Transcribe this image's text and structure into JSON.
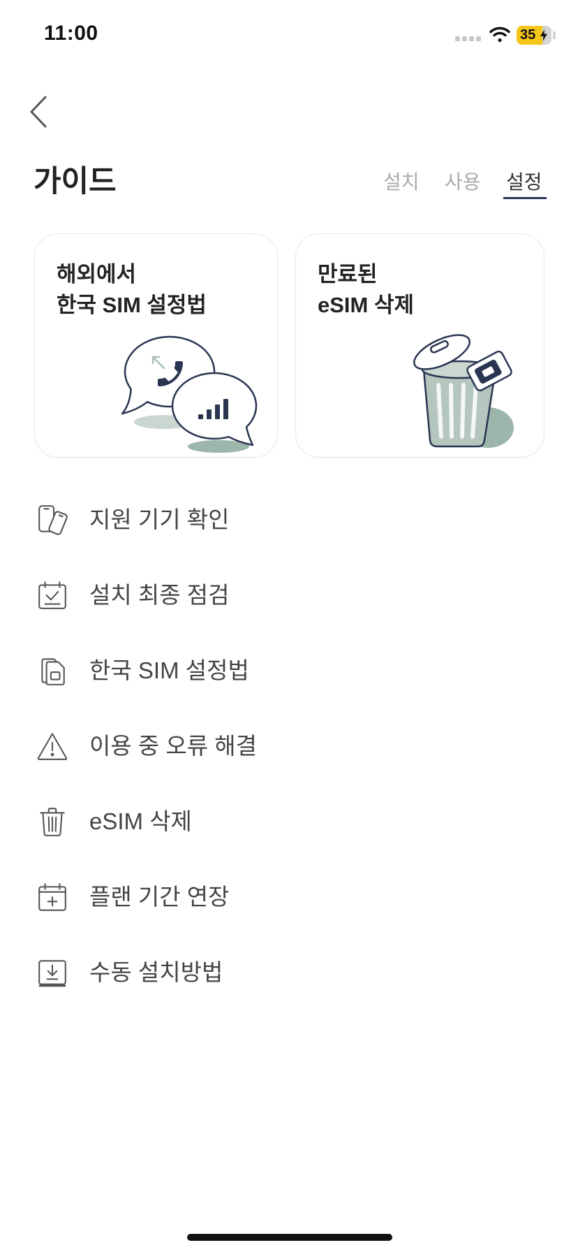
{
  "status_bar": {
    "time": "11:00",
    "battery_percent": "35",
    "icons": [
      "signal-dots-icon",
      "wifi-icon",
      "battery-icon",
      "charging-bolt-icon"
    ]
  },
  "nav": {
    "back_icon": "chevron-left-icon"
  },
  "header": {
    "title": "가이드",
    "tabs": [
      {
        "label": "설치",
        "selected": false
      },
      {
        "label": "사용",
        "selected": false
      },
      {
        "label": "설정",
        "selected": true
      }
    ]
  },
  "cards": [
    {
      "line1": "해외에서",
      "line2": "한국 SIM 설정법",
      "illustration": "speech-bubbles-phone-signal"
    },
    {
      "line1": "만료된",
      "line2": "eSIM 삭제",
      "illustration": "trash-can-phone"
    }
  ],
  "menu": {
    "items": [
      {
        "label": "지원 기기 확인",
        "icon": "devices-icon"
      },
      {
        "label": "설치 최종 점검",
        "icon": "calendar-check-icon"
      },
      {
        "label": "한국 SIM 설정법",
        "icon": "sim-cards-icon"
      },
      {
        "label": "이용 중 오류 해결",
        "icon": "warning-icon"
      },
      {
        "label": "eSIM 삭제",
        "icon": "trash-icon"
      },
      {
        "label": "플랜 기간 연장",
        "icon": "calendar-plus-icon"
      },
      {
        "label": "수동 설치방법",
        "icon": "download-tray-icon"
      }
    ]
  },
  "colors": {
    "text_primary": "#222222",
    "text_secondary": "#444444",
    "tab_inactive": "#aaaaaa",
    "accent_navy": "#2a3552",
    "illustration_green": "#9db6ab",
    "illustration_light_green": "#c9d7d0",
    "battery_fill": "#f5c518"
  }
}
